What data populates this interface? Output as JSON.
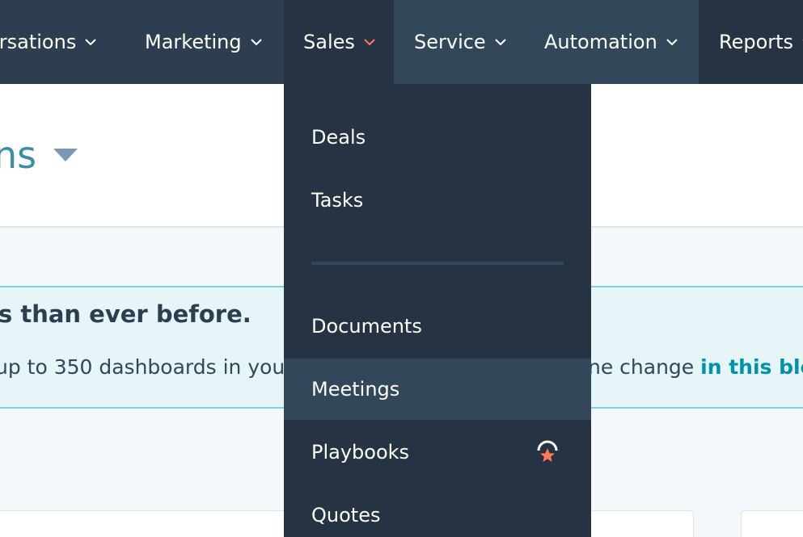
{
  "nav": {
    "items": [
      {
        "label": "ersations",
        "key": "conversations"
      },
      {
        "label": "Marketing",
        "key": "marketing"
      },
      {
        "label": "Sales",
        "key": "sales"
      },
      {
        "label": "Service",
        "key": "service"
      },
      {
        "label": "Automation",
        "key": "automation"
      },
      {
        "label": "Reports",
        "key": "reports"
      }
    ],
    "active": "Sales"
  },
  "page": {
    "title_fragment": "ns"
  },
  "banner": {
    "heading_fragment": "s than ever before.",
    "body_left": "up to 350 dashboards in you",
    "body_right": "ne change ",
    "link": "in this blo"
  },
  "dropdown": {
    "items": [
      {
        "label": "Deals"
      },
      {
        "label": "Tasks"
      },
      {
        "label": "Documents"
      },
      {
        "label": "Meetings"
      },
      {
        "label": "Playbooks",
        "badge_icon": "award-star-icon"
      },
      {
        "label": "Quotes"
      }
    ],
    "highlighted": "Meetings"
  },
  "colors": {
    "nav_bg": "#2d3e50",
    "menu_bg": "#253342",
    "accent": "#ff7a59",
    "link": "#0091ae"
  }
}
